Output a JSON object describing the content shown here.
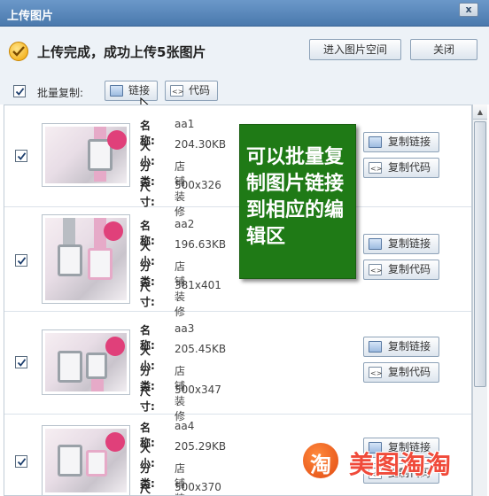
{
  "window": {
    "title": "上传图片",
    "close_glyph": "x"
  },
  "header": {
    "status_text": "上传完成，成功上传5张图片",
    "status_icon": "check-icon",
    "enter_space_label": "进入图片空间",
    "close_label": "关闭"
  },
  "batch": {
    "checked": true,
    "label": "批量复制:",
    "link_label": "链接",
    "code_label": "代码"
  },
  "field_labels": {
    "name": "名称:",
    "size": "大小:",
    "category": "分类:",
    "dims": "尺寸:"
  },
  "items": [
    {
      "checked": true,
      "name": "aa1",
      "size": "204.30KB",
      "category": "店铺装修",
      "dims": "500x326",
      "copy_link": "复制链接",
      "copy_code": "复制代码"
    },
    {
      "checked": true,
      "name": "aa2",
      "size": "196.63KB",
      "category": "店铺装修",
      "dims": "381x401",
      "copy_link": "复制链接",
      "copy_code": "复制代码"
    },
    {
      "checked": true,
      "name": "aa3",
      "size": "205.45KB",
      "category": "店铺装修",
      "dims": "500x347",
      "copy_link": "复制链接",
      "copy_code": "复制代码"
    },
    {
      "checked": true,
      "name": "aa4",
      "size": "205.29KB",
      "category": "店铺装修",
      "dims": "500x370",
      "copy_link": "复制链接",
      "copy_code": "复制代码"
    }
  ],
  "annotation": {
    "text": "可以批量复制图片链接到相应的编辑区",
    "color": "#1f7a16"
  },
  "watermark": {
    "logo_char": "淘",
    "text": "美图淘淘"
  },
  "colors": {
    "titlebar": "#5a88bb",
    "accent_green": "#1f7a16",
    "watermark_red": "#f04a3a"
  }
}
